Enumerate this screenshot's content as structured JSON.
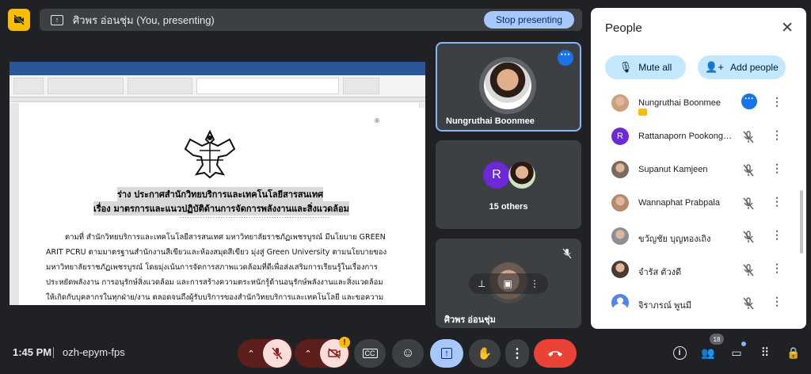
{
  "topbar": {
    "presenting_label": "ศิวพร อ่อนชุ่ม (You, presenting)",
    "stop_presenting": "Stop presenting"
  },
  "shared_doc": {
    "heading1": "ร่าง ประกาศสำนักวิทยบริการและเทคโนโลยีสารสนเทศ",
    "heading2": "เรื่อง มาตรการและแนวปฏิบัติด้านการจัดการพลังงานและสิ่งแวดล้อม",
    "dots": "...........................................................",
    "lines": [
      "ตามที่ สำนักวิทยบริการและเทคโนโลยีสารสนเทศ มหาวิทยาลัยราชภัฏเพชรบูรณ์ มีนโยบาย GREEN",
      "ARIT PCRU ตามมาตรฐานสำนักงานสีเขียวและห้องสมุดสีเขียว มุ่งสู่ Green University ตามนโยบายของ",
      "มหาวิทยาลัยราชภัฏเพชรบูรณ์ โดยมุ่งเน้นการจัดการสภาพแวดล้อมที่ดีเพื่อส่งเสริมการเรียนรู้ในเรื่องการ",
      "ประหยัดพลังงาน การอนุรักษ์สิ่งแวดล้อม และการสร้างความตระหนักรู้ด้านอนุรักษ์พลังงานและสิ่งแวดล้อม",
      "ให้เกิดกับบุคลากรในทุกฝ่าย/งาน ตลอดจนถึงผู้รับบริการของสำนักวิทยบริการและเทคโนโลยี และขอความ"
    ]
  },
  "tiles": {
    "pinned_name": "Nungruthai Boonmee",
    "others_initial": "R",
    "others_label": "15 others",
    "self_name": "ศิวพร อ่อนชุ่ม"
  },
  "people_panel": {
    "title": "People",
    "mute_all": "Mute all",
    "add_people": "Add people",
    "people": [
      {
        "name": "Nungruthai Boonmee",
        "avatar": "photo",
        "color": "#caa07f"
      },
      {
        "name": "Rattanaporn Pookongchai",
        "avatar": "R",
        "color": "#6d28d9"
      },
      {
        "name": "Supanut Kamjeen",
        "avatar": "photo",
        "color": "#7a6b60"
      },
      {
        "name": "Wannaphat Prabpala",
        "avatar": "photo",
        "color": "#b58a6e"
      },
      {
        "name": "ขวัญชัย บุญทองเถิง",
        "avatar": "photo",
        "color": "#8a8f98"
      },
      {
        "name": "จำรัส ตัวงดี",
        "avatar": "photo",
        "color": "#4a3b32"
      },
      {
        "name": "จิราภรณ์ พูนมี",
        "avatar": "person",
        "color": "#4f86e8"
      }
    ]
  },
  "bottombar": {
    "time": "1:45 PM",
    "meeting_code": "ozh-epym-fps",
    "people_count": "18",
    "warning": "!"
  }
}
